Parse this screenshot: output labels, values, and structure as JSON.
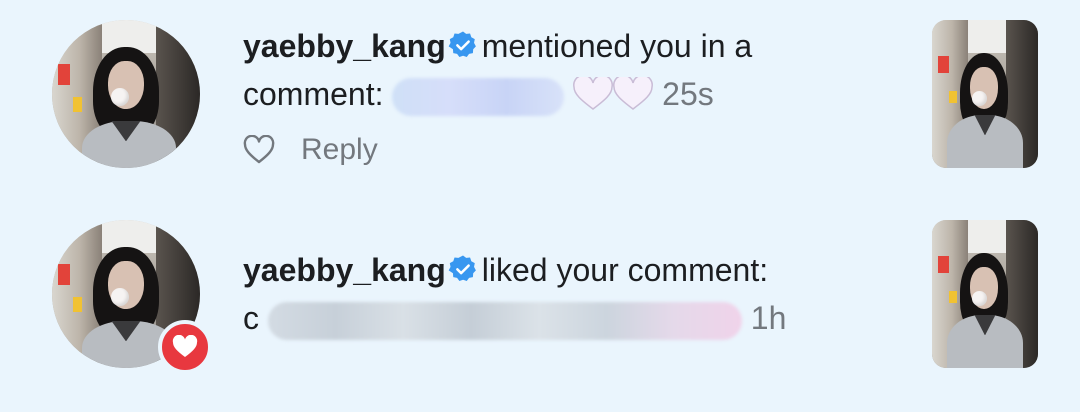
{
  "notifications": [
    {
      "username": "yaebby_kang",
      "verified": true,
      "action_text": "mentioned you in a",
      "comment_label": "comment:",
      "emojis": [
        "white-heart",
        "white-heart"
      ],
      "time": "25s",
      "reply_label": "Reply",
      "avatar_icon": "profile-photo",
      "thumbnail_icon": "post-thumbnail"
    },
    {
      "username": "yaebby_kang",
      "verified": true,
      "action_text": "liked your comment:",
      "comment_prefix": "c",
      "time": "1h",
      "badge_icon": "heart-badge-icon",
      "badge_color": "#e8383f",
      "avatar_icon": "profile-photo",
      "thumbnail_icon": "post-thumbnail"
    }
  ],
  "colors": {
    "background": "#eaf5fd",
    "verified": "#3897f0",
    "secondary_text": "#73787e"
  }
}
